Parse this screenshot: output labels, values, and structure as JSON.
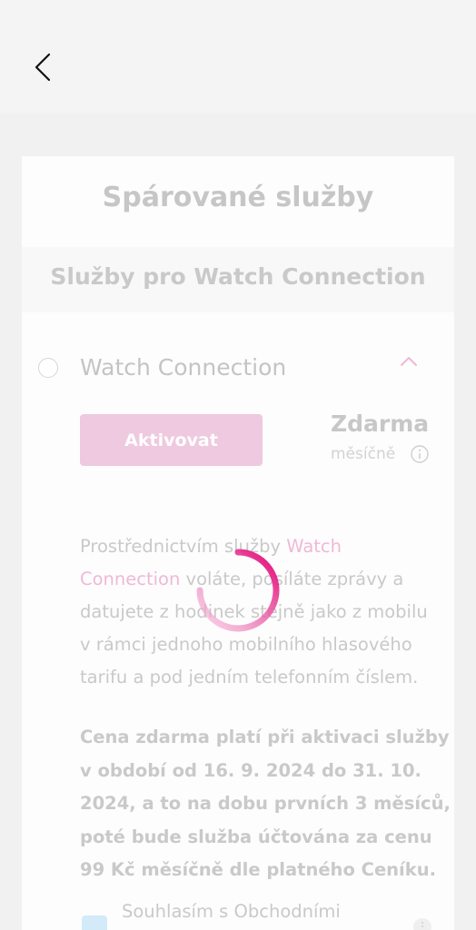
{
  "header": {
    "back_icon": "chevron-left-icon"
  },
  "card": {
    "title": "Spárované služby",
    "section_title": "Služby pro Watch Connection"
  },
  "service": {
    "name": "Watch Connection",
    "activate_label": "Aktivovat",
    "price": "Zdarma",
    "period": "měsíčně",
    "description_prefix": "Prostřednictvím služby ",
    "description_link": "Watch Connection",
    "description_suffix": " voláte, posíláte zprávy a datujete z hodinek stejně jako z mobilu v rámci jednoho mobilního hlasového tarifu a pod jedním telefonním číslem.",
    "note": "Cena zdarma platí při aktivaci služby v období od 16. 9. 2024 do 31. 10. 2024, a to na dobu prvních 3 měsíců, poté bude služba účtována za cenu 99 Kč měsíčně dle platného Ceníku.",
    "consent_label": "Souhlasím s Obchodními"
  },
  "colors": {
    "accent": "#e20074",
    "spinner_tail": "#f2b3d4",
    "background": "#f1f1f1",
    "card": "#fdfdfd"
  },
  "loading": {
    "icon": "loading-spinner-icon"
  }
}
